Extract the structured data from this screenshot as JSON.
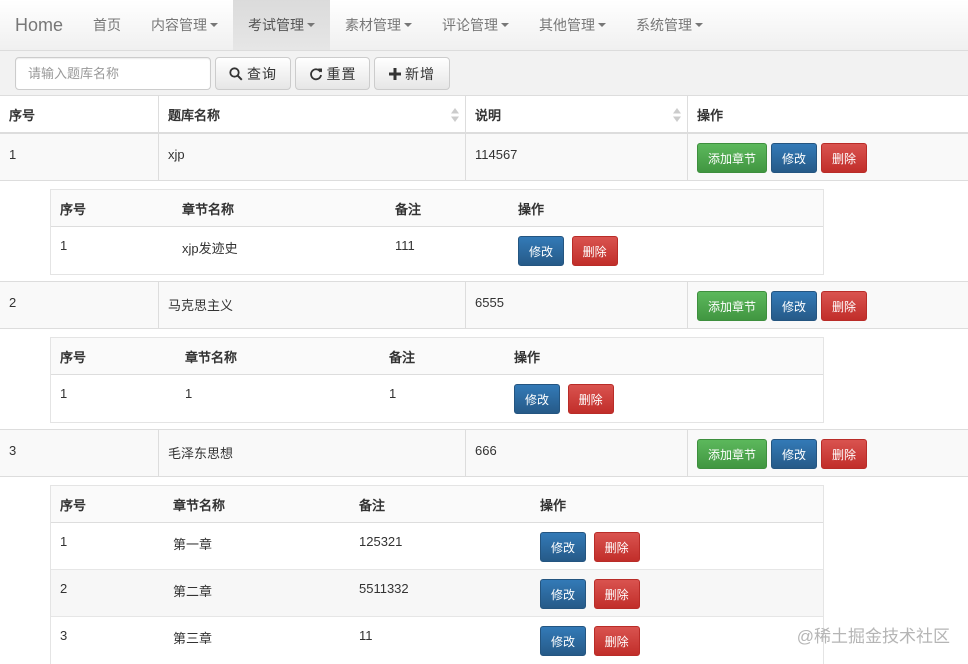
{
  "navbar": {
    "brand": "Home",
    "items": [
      {
        "label": "首页",
        "dropdown": false,
        "active": false
      },
      {
        "label": "内容管理",
        "dropdown": true,
        "active": false
      },
      {
        "label": "考试管理",
        "dropdown": true,
        "active": true
      },
      {
        "label": "素材管理",
        "dropdown": true,
        "active": false
      },
      {
        "label": "评论管理",
        "dropdown": true,
        "active": false
      },
      {
        "label": "其他管理",
        "dropdown": true,
        "active": false
      },
      {
        "label": "系统管理",
        "dropdown": true,
        "active": false
      }
    ]
  },
  "toolbar": {
    "search_placeholder": "请输入题库名称",
    "query_label": "查询",
    "reset_label": "重置",
    "add_label": "新增"
  },
  "table": {
    "headers": [
      "序号",
      "题库名称",
      "说明",
      "操作"
    ],
    "buttons": {
      "add_chapter": "添加章节",
      "edit": "修改",
      "delete": "删除"
    },
    "rows": [
      {
        "no": "1",
        "name": "xjp",
        "desc": "114567",
        "sub_headers": [
          "序号",
          "章节名称",
          "备注",
          "操作"
        ],
        "chapters": [
          {
            "no": "1",
            "name": "xjp发迹史",
            "note": "111"
          }
        ]
      },
      {
        "no": "2",
        "name": "马克思主义",
        "desc": "6555",
        "sub_headers": [
          "序号",
          "章节名称",
          "备注",
          "操作"
        ],
        "chapters": [
          {
            "no": "1",
            "name": "1",
            "note": "1"
          }
        ]
      },
      {
        "no": "3",
        "name": "毛泽东思想",
        "desc": "666",
        "sub_headers": [
          "序号",
          "章节名称",
          "备注",
          "操作"
        ],
        "chapters": [
          {
            "no": "1",
            "name": "第一章",
            "note": "125321"
          },
          {
            "no": "2",
            "name": "第二章",
            "note": "5511332"
          },
          {
            "no": "3",
            "name": "第三章",
            "note": "11"
          }
        ]
      }
    ]
  },
  "watermark": "@稀土掘金技术社区"
}
